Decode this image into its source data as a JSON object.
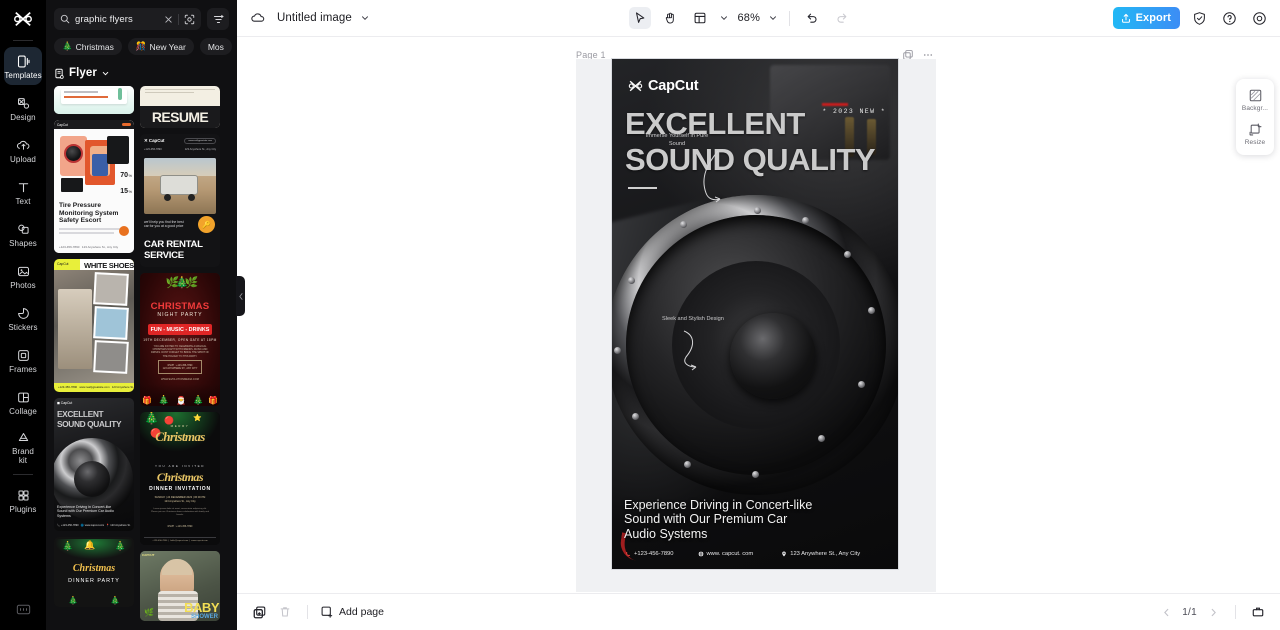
{
  "rail": {
    "logo_icon": "capcut-logo-icon",
    "items": [
      {
        "label": "Templates",
        "icon": "templates-icon",
        "active": true
      },
      {
        "label": "Design",
        "icon": "design-icon",
        "active": false
      },
      {
        "label": "Upload",
        "icon": "upload-icon",
        "active": false
      },
      {
        "label": "Text",
        "icon": "text-icon",
        "active": false
      },
      {
        "label": "Shapes",
        "icon": "shapes-icon",
        "active": false
      },
      {
        "label": "Photos",
        "icon": "photos-icon",
        "active": false
      },
      {
        "label": "Stickers",
        "icon": "stickers-icon",
        "active": false
      },
      {
        "label": "Frames",
        "icon": "frames-icon",
        "active": false
      },
      {
        "label": "Collage",
        "icon": "collage-icon",
        "active": false
      },
      {
        "label": "Brand\nkit",
        "icon": "brand-kit-icon",
        "active": false
      },
      {
        "label": "Plugins",
        "icon": "plugins-icon",
        "active": false
      }
    ],
    "bottom_icon": "keyboard-shortcuts-icon"
  },
  "panel": {
    "search": {
      "value": "graphic flyers",
      "placeholder": "Search templates",
      "search_icon": "search-icon",
      "clear_icon": "close-icon",
      "visual_icon": "visual-search-icon"
    },
    "filter_icon": "filter-icon",
    "chips": [
      {
        "label": "Christmas",
        "icon": "christmas-tree-icon"
      },
      {
        "label": "New Year",
        "icon": "fireworks-icon"
      },
      {
        "label": "Mos",
        "icon": ""
      }
    ],
    "category": {
      "label": "Flyer",
      "icon": "flyer-icon",
      "chevron": "chevron-down-icon"
    },
    "collapse_icon": "chevron-left-icon",
    "templates_left": [
      {
        "name": "green-contact-flyer",
        "title": ""
      },
      {
        "name": "tire-pressure-flyer",
        "title": "Tire Pressure Monitoring System Safety Escort",
        "stat1": "70",
        "stat2": "15"
      },
      {
        "name": "white-shoes-flyer",
        "title": "WHITE SHOES"
      },
      {
        "name": "excellent-sound-quality-flyer",
        "title": "EXCELLENT SOUND QUALITY"
      },
      {
        "name": "christmas-dinner-party-flyer",
        "title": "Christmas",
        "subtitle": "DINNER PARTY"
      }
    ],
    "templates_right": [
      {
        "name": "resume-flyer",
        "title": "RESUME"
      },
      {
        "name": "car-rental-service-flyer",
        "title": "CAR RENTAL SERVICE",
        "body": "we'll help you find the best car for you at a good price"
      },
      {
        "name": "christmas-night-party-flyer",
        "title": "CHRISTMAS",
        "subtitle": "NIGHT PARTY",
        "banner": "FUN - MUSIC - DRINKS"
      },
      {
        "name": "merry-christmas-dinner-invitation-flyer",
        "title": "Christmas",
        "subtitle": "DINNER INVITATION",
        "eyebrow": "YOU ARE INVITED"
      },
      {
        "name": "baby-flyer",
        "title": "BABY"
      }
    ]
  },
  "topbar": {
    "cloud_icon": "cloud-sync-icon",
    "doc_title": "Untitled image",
    "title_chevron": "chevron-down-icon",
    "select_icon": "cursor-select-icon",
    "hand_icon": "hand-pan-icon",
    "layout_icon": "layout-icon",
    "layout_chevron": "chevron-down-icon",
    "zoom": "68%",
    "zoom_chevron": "chevron-down-icon",
    "undo_icon": "undo-icon",
    "redo_icon": "redo-icon",
    "export_label": "Export",
    "export_icon": "export-upload-icon",
    "export_color": "#2fb4f2",
    "shield_icon": "shield-check-icon",
    "help_icon": "help-circle-icon",
    "settings_icon": "gear-icon"
  },
  "canvas": {
    "page_label": "Page 1",
    "duplicate_icon": "duplicate-page-icon",
    "more_icon": "more-options-icon"
  },
  "right_panel": {
    "items": [
      {
        "label": "Backgr...",
        "icon": "background-icon",
        "name": "background-button"
      },
      {
        "label": "Resize",
        "icon": "resize-icon",
        "name": "resize-button"
      }
    ]
  },
  "artboard": {
    "brand": "CapCut",
    "brand_icon": "capcut-logo-icon",
    "headline_line1": "EXCELLENT",
    "headline_line2": "SOUND QUALITY",
    "badge": "* 2023  NEW *",
    "caption_1": "Immerse Yourself in Pure Sound",
    "caption_2": "Sleek and Stylish Design",
    "footer_text": "Experience Driving in Concert-like Sound with Our Premium Car Audio Systems",
    "contact": {
      "phone": "+123-456-7890",
      "phone_icon": "phone-icon",
      "website": "www. capcut. com",
      "website_icon": "globe-icon",
      "address": "123 Anywhere St., Any City",
      "address_icon": "location-pin-icon"
    }
  },
  "bottombar": {
    "duplicate_icon": "duplicate-icon",
    "delete_icon": "trash-icon",
    "add_page_label": "Add page",
    "add_page_icon": "add-page-icon",
    "prev_icon": "chevron-left-icon",
    "next_icon": "chevron-right-icon",
    "page_count": "1/1",
    "present_icon": "present-icon"
  }
}
